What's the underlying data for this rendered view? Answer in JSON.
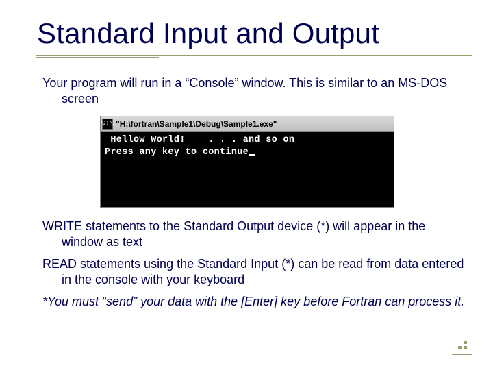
{
  "title": "Standard Input and Output",
  "para1": "Your program will run in a “Console” window.  This is similar to an MS-DOS screen",
  "console": {
    "title_path": "\"H:\\fortran\\Sample1\\Debug\\Sample1.exe\"",
    "line1": " Hellow World!    . . . and so on",
    "line2": "Press any key to continue"
  },
  "para2": "WRITE statements to the Standard Output device (*) will appear in the window as text",
  "para3": "READ statements using the Standard Input (*) can be read from data entered in the console with your keyboard",
  "para4": "*You must “send” your data with the [Enter] key before Fortran can process it."
}
